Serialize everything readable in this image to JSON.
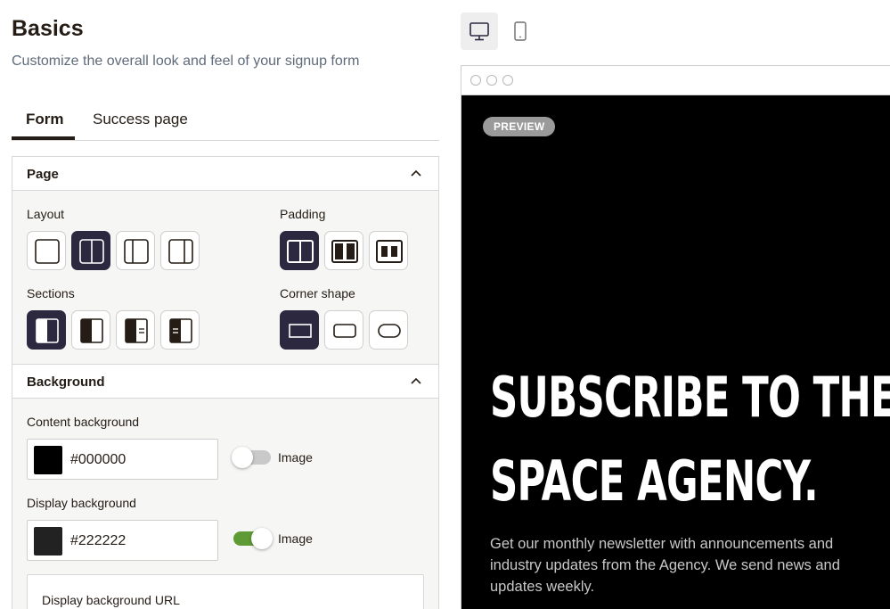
{
  "header": {
    "title": "Basics",
    "subtitle": "Customize the overall look and feel of your signup form"
  },
  "tabs": [
    {
      "label": "Form",
      "active": true
    },
    {
      "label": "Success page",
      "active": false
    }
  ],
  "page_section": {
    "title": "Page",
    "expanded": true,
    "layout": {
      "label": "Layout",
      "selected_index": 1
    },
    "padding": {
      "label": "Padding",
      "selected_index": 0
    },
    "sections": {
      "label": "Sections",
      "selected_index": 0
    },
    "corner_shape": {
      "label": "Corner shape",
      "selected_index": 0
    }
  },
  "background_section": {
    "title": "Background",
    "expanded": true,
    "content_background": {
      "label": "Content background",
      "value": "#000000",
      "swatch_color": "#000000",
      "image_toggle": {
        "label": "Image",
        "on": false
      }
    },
    "display_background": {
      "label": "Display background",
      "value": "#222222",
      "swatch_color": "#222222",
      "image_toggle": {
        "label": "Image",
        "on": true
      }
    },
    "display_background_url": {
      "label": "Display background URL"
    }
  },
  "device_toggle": {
    "options": [
      {
        "icon": "desktop-icon",
        "selected": true
      },
      {
        "icon": "mobile-icon",
        "selected": false
      }
    ]
  },
  "preview": {
    "badge": "PREVIEW",
    "headline_line1": "SUBSCRIBE TO THE",
    "headline_line2": "SPACE AGENCY.",
    "body": "Get our monthly newsletter with announcements and industry updates from the Agency. We send news and updates weekly."
  },
  "colors": {
    "accent_dark": "#2b2840",
    "toggle_on": "#5e9a36",
    "toggle_off": "#c9c9c9"
  }
}
